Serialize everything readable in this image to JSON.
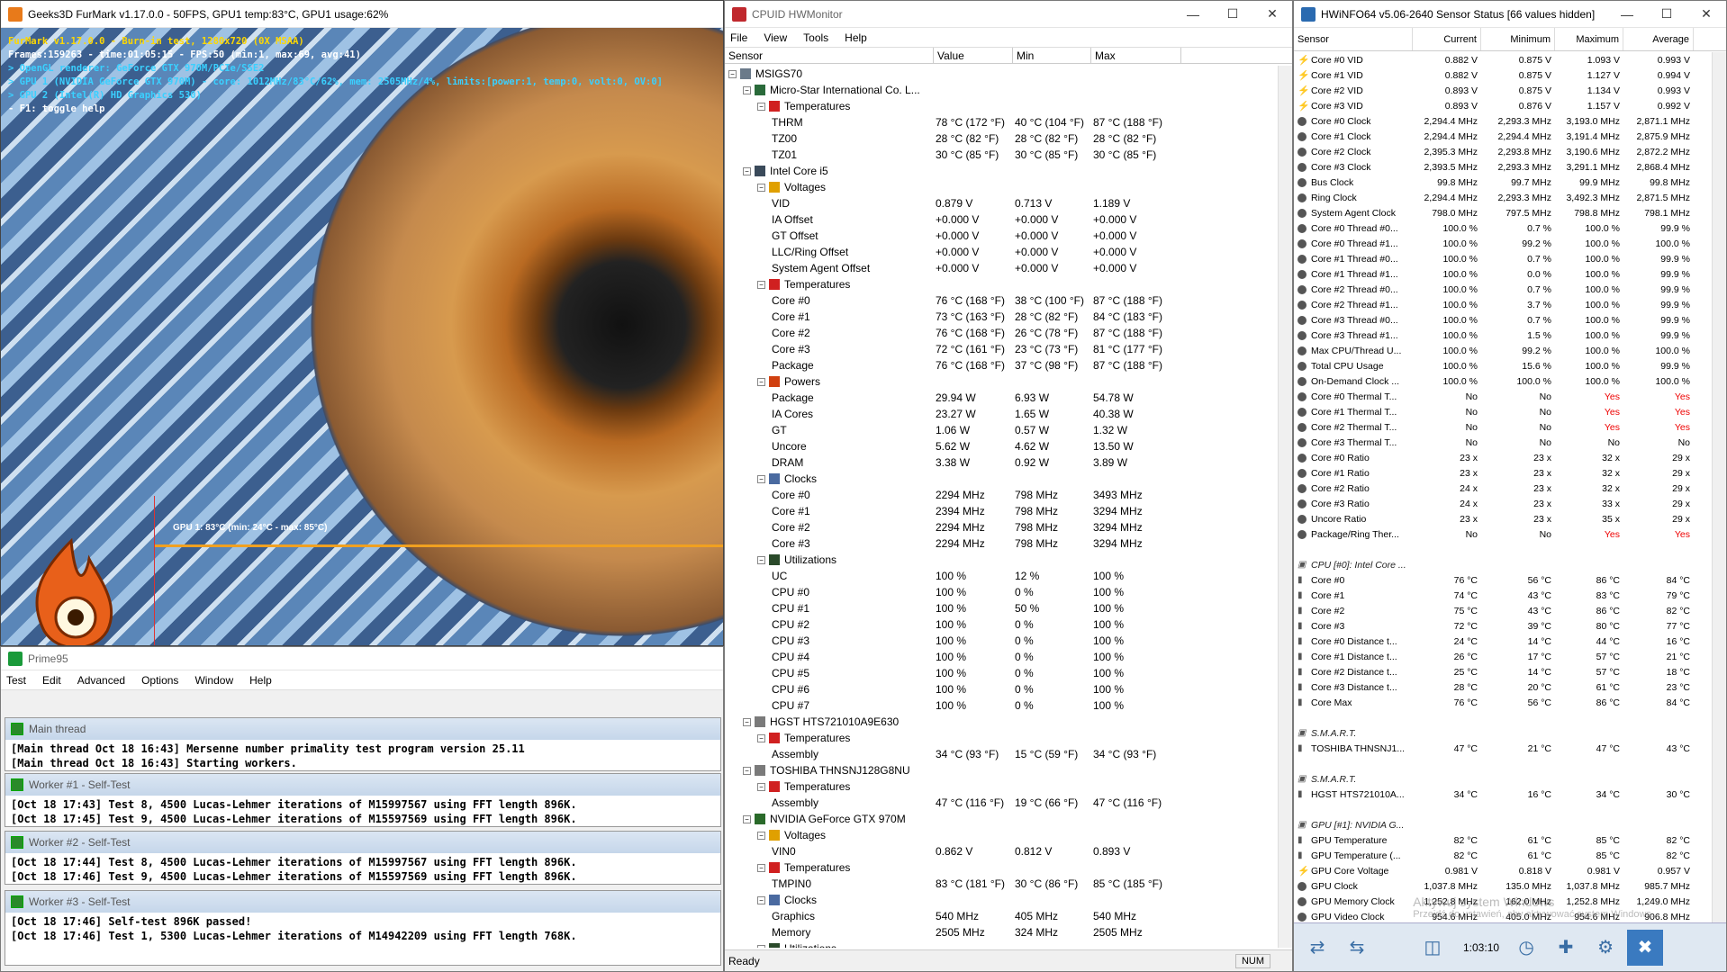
{
  "furmark": {
    "title": "Geeks3D FurMark v1.17.0.0 - 50FPS, GPU1 temp:83°C, GPU1 usage:62%",
    "hud": [
      {
        "text": "FurMark v1.17.0.0 - Burn-in test, 1280x720 (0X MSAA)",
        "color": "#ffd800"
      },
      {
        "text": "Frames:159263 - time:01:05:15 - FPS:50 (min:1, max:69, avg:41)",
        "color": "#ffffff"
      },
      {
        "text": "> OpenGL renderer: GeForce GTX 970M/PCIe/SSE2",
        "color": "#3ad0ff"
      },
      {
        "text": "> GPU 1 (NVIDIA GeForce GTX 970M) - core: 1012MHz/83°C/62%, mem: 2505MHz/4%, limits:[power:1, temp:0, volt:0, OV:0]",
        "color": "#3ad0ff"
      },
      {
        "text": "> GPU 2 (Intel(R) HD Graphics 530)",
        "color": "#3ad0ff"
      },
      {
        "text": "- F1: toggle help",
        "color": "#ffffff"
      }
    ],
    "graph_label": "GPU 1: 83°C (min: 24°C - max: 85°C)"
  },
  "prime95": {
    "title": "Prime95",
    "menu": [
      "Test",
      "Edit",
      "Advanced",
      "Options",
      "Window",
      "Help"
    ],
    "windows": [
      {
        "title": "Main thread",
        "lines": [
          "[Main thread Oct 18 16:43] Mersenne number primality test program version 25.11",
          "[Main thread Oct 18 16:43] Starting workers."
        ]
      },
      {
        "title": "Worker #1 - Self-Test",
        "lines": [
          "[Oct 18 17:43] Test 8, 4500 Lucas-Lehmer iterations of M15997567 using FFT length 896K.",
          "[Oct 18 17:45] Test 9, 4500 Lucas-Lehmer iterations of M15597569 using FFT length 896K."
        ]
      },
      {
        "title": "Worker #2 - Self-Test",
        "lines": [
          "[Oct 18 17:44] Test 8, 4500 Lucas-Lehmer iterations of M15997567 using FFT length 896K.",
          "[Oct 18 17:46] Test 9, 4500 Lucas-Lehmer iterations of M15597569 using FFT length 896K."
        ]
      },
      {
        "title": "Worker #3 - Self-Test",
        "lines": [
          "[Oct 18 17:46] Self-test 896K passed!",
          "[Oct 18 17:46] Test 1, 5300 Lucas-Lehmer iterations of M14942209 using FFT length 768K."
        ]
      }
    ]
  },
  "hwmonitor": {
    "title": "CPUID HWMonitor",
    "menu": [
      "File",
      "View",
      "Tools",
      "Help"
    ],
    "columns": [
      "Sensor",
      "Value",
      "Min",
      "Max"
    ],
    "status": "Ready",
    "num": "NUM",
    "rows": [
      {
        "lvl": 0,
        "t": "MSIGS70",
        "v": "",
        "mi": "",
        "ma": "",
        "ic": "pc"
      },
      {
        "lvl": 1,
        "t": "Micro-Star International Co. L...",
        "v": "",
        "mi": "",
        "ma": "",
        "ic": "board"
      },
      {
        "lvl": 2,
        "t": "Temperatures",
        "v": "",
        "mi": "",
        "ma": "",
        "ic": "temp"
      },
      {
        "lvl": 3,
        "t": "THRM",
        "v": "78 °C  (172 °F)",
        "mi": "40 °C  (104 °F)",
        "ma": "87 °C  (188 °F)"
      },
      {
        "lvl": 3,
        "t": "TZ00",
        "v": "28 °C  (82 °F)",
        "mi": "28 °C  (82 °F)",
        "ma": "28 °C  (82 °F)"
      },
      {
        "lvl": 3,
        "t": "TZ01",
        "v": "30 °C  (85 °F)",
        "mi": "30 °C  (85 °F)",
        "ma": "30 °C  (85 °F)"
      },
      {
        "lvl": 1,
        "t": "Intel Core i5",
        "v": "",
        "mi": "",
        "ma": "",
        "ic": "chip"
      },
      {
        "lvl": 2,
        "t": "Voltages",
        "v": "",
        "mi": "",
        "ma": "",
        "ic": "volt"
      },
      {
        "lvl": 3,
        "t": "VID",
        "v": "0.879 V",
        "mi": "0.713 V",
        "ma": "1.189 V"
      },
      {
        "lvl": 3,
        "t": "IA Offset",
        "v": "+0.000 V",
        "mi": "+0.000 V",
        "ma": "+0.000 V"
      },
      {
        "lvl": 3,
        "t": "GT Offset",
        "v": "+0.000 V",
        "mi": "+0.000 V",
        "ma": "+0.000 V"
      },
      {
        "lvl": 3,
        "t": "LLC/Ring Offset",
        "v": "+0.000 V",
        "mi": "+0.000 V",
        "ma": "+0.000 V"
      },
      {
        "lvl": 3,
        "t": "System Agent Offset",
        "v": "+0.000 V",
        "mi": "+0.000 V",
        "ma": "+0.000 V"
      },
      {
        "lvl": 2,
        "t": "Temperatures",
        "v": "",
        "mi": "",
        "ma": "",
        "ic": "temp"
      },
      {
        "lvl": 3,
        "t": "Core #0",
        "v": "76 °C  (168 °F)",
        "mi": "38 °C  (100 °F)",
        "ma": "87 °C  (188 °F)"
      },
      {
        "lvl": 3,
        "t": "Core #1",
        "v": "73 °C  (163 °F)",
        "mi": "28 °C  (82 °F)",
        "ma": "84 °C  (183 °F)"
      },
      {
        "lvl": 3,
        "t": "Core #2",
        "v": "76 °C  (168 °F)",
        "mi": "26 °C  (78 °F)",
        "ma": "87 °C  (188 °F)"
      },
      {
        "lvl": 3,
        "t": "Core #3",
        "v": "72 °C  (161 °F)",
        "mi": "23 °C  (73 °F)",
        "ma": "81 °C  (177 °F)"
      },
      {
        "lvl": 3,
        "t": "Package",
        "v": "76 °C  (168 °F)",
        "mi": "37 °C  (98 °F)",
        "ma": "87 °C  (188 °F)"
      },
      {
        "lvl": 2,
        "t": "Powers",
        "v": "",
        "mi": "",
        "ma": "",
        "ic": "power"
      },
      {
        "lvl": 3,
        "t": "Package",
        "v": "29.94 W",
        "mi": "6.93 W",
        "ma": "54.78 W"
      },
      {
        "lvl": 3,
        "t": "IA Cores",
        "v": "23.27 W",
        "mi": "1.65 W",
        "ma": "40.38 W"
      },
      {
        "lvl": 3,
        "t": "GT",
        "v": "1.06 W",
        "mi": "0.57 W",
        "ma": "1.32 W"
      },
      {
        "lvl": 3,
        "t": "Uncore",
        "v": "5.62 W",
        "mi": "4.62 W",
        "ma": "13.50 W"
      },
      {
        "lvl": 3,
        "t": "DRAM",
        "v": "3.38 W",
        "mi": "0.92 W",
        "ma": "3.89 W"
      },
      {
        "lvl": 2,
        "t": "Clocks",
        "v": "",
        "mi": "",
        "ma": "",
        "ic": "clock"
      },
      {
        "lvl": 3,
        "t": "Core #0",
        "v": "2294 MHz",
        "mi": "798 MHz",
        "ma": "3493 MHz"
      },
      {
        "lvl": 3,
        "t": "Core #1",
        "v": "2394 MHz",
        "mi": "798 MHz",
        "ma": "3294 MHz"
      },
      {
        "lvl": 3,
        "t": "Core #2",
        "v": "2294 MHz",
        "mi": "798 MHz",
        "ma": "3294 MHz"
      },
      {
        "lvl": 3,
        "t": "Core #3",
        "v": "2294 MHz",
        "mi": "798 MHz",
        "ma": "3294 MHz"
      },
      {
        "lvl": 2,
        "t": "Utilizations",
        "v": "",
        "mi": "",
        "ma": "",
        "ic": "util"
      },
      {
        "lvl": 3,
        "t": "UC",
        "v": "100 %",
        "mi": "12 %",
        "ma": "100 %"
      },
      {
        "lvl": 3,
        "t": "CPU #0",
        "v": "100 %",
        "mi": "0 %",
        "ma": "100 %"
      },
      {
        "lvl": 3,
        "t": "CPU #1",
        "v": "100 %",
        "mi": "50 %",
        "ma": "100 %"
      },
      {
        "lvl": 3,
        "t": "CPU #2",
        "v": "100 %",
        "mi": "0 %",
        "ma": "100 %"
      },
      {
        "lvl": 3,
        "t": "CPU #3",
        "v": "100 %",
        "mi": "0 %",
        "ma": "100 %"
      },
      {
        "lvl": 3,
        "t": "CPU #4",
        "v": "100 %",
        "mi": "0 %",
        "ma": "100 %"
      },
      {
        "lvl": 3,
        "t": "CPU #5",
        "v": "100 %",
        "mi": "0 %",
        "ma": "100 %"
      },
      {
        "lvl": 3,
        "t": "CPU #6",
        "v": "100 %",
        "mi": "0 %",
        "ma": "100 %"
      },
      {
        "lvl": 3,
        "t": "CPU #7",
        "v": "100 %",
        "mi": "0 %",
        "ma": "100 %"
      },
      {
        "lvl": 1,
        "t": "HGST HTS721010A9E630",
        "v": "",
        "mi": "",
        "ma": "",
        "ic": "disk"
      },
      {
        "lvl": 2,
        "t": "Temperatures",
        "v": "",
        "mi": "",
        "ma": "",
        "ic": "temp"
      },
      {
        "lvl": 3,
        "t": "Assembly",
        "v": "34 °C  (93 °F)",
        "mi": "15 °C  (59 °F)",
        "ma": "34 °C  (93 °F)"
      },
      {
        "lvl": 1,
        "t": "TOSHIBA THNSNJ128G8NU",
        "v": "",
        "mi": "",
        "ma": "",
        "ic": "disk"
      },
      {
        "lvl": 2,
        "t": "Temperatures",
        "v": "",
        "mi": "",
        "ma": "",
        "ic": "temp"
      },
      {
        "lvl": 3,
        "t": "Assembly",
        "v": "47 °C  (116 °F)",
        "mi": "19 °C  (66 °F)",
        "ma": "47 °C  (116 °F)"
      },
      {
        "lvl": 1,
        "t": "NVIDIA GeForce GTX 970M",
        "v": "",
        "mi": "",
        "ma": "",
        "ic": "gpu"
      },
      {
        "lvl": 2,
        "t": "Voltages",
        "v": "",
        "mi": "",
        "ma": "",
        "ic": "volt"
      },
      {
        "lvl": 3,
        "t": "VIN0",
        "v": "0.862 V",
        "mi": "0.812 V",
        "ma": "0.893 V"
      },
      {
        "lvl": 2,
        "t": "Temperatures",
        "v": "",
        "mi": "",
        "ma": "",
        "ic": "temp"
      },
      {
        "lvl": 3,
        "t": "TMPIN0",
        "v": "83 °C  (181 °F)",
        "mi": "30 °C  (86 °F)",
        "ma": "85 °C  (185 °F)"
      },
      {
        "lvl": 2,
        "t": "Clocks",
        "v": "",
        "mi": "",
        "ma": "",
        "ic": "clock"
      },
      {
        "lvl": 3,
        "t": "Graphics",
        "v": "540 MHz",
        "mi": "405 MHz",
        "ma": "540 MHz"
      },
      {
        "lvl": 3,
        "t": "Memory",
        "v": "2505 MHz",
        "mi": "324 MHz",
        "ma": "2505 MHz"
      },
      {
        "lvl": 2,
        "t": "Utilizations",
        "v": "",
        "mi": "",
        "ma": "",
        "ic": "util"
      }
    ]
  },
  "hwinfo": {
    "title": "HWiNFO64 v5.06-2640 Sensor Status [66 values hidden]",
    "columns": [
      "Sensor",
      "Current",
      "Minimum",
      "Maximum",
      "Average"
    ],
    "elapsed": "1:03:10",
    "watermark": [
      "Aktywuj system Windows",
      "Przejdź do ustawień, aby aktywować system Windows."
    ],
    "rows": [
      {
        "k": "volt",
        "n": "Core #0 VID",
        "c": "0.882 V",
        "mi": "0.875 V",
        "ma": "1.093 V",
        "a": "0.993 V"
      },
      {
        "k": "volt",
        "n": "Core #1 VID",
        "c": "0.882 V",
        "mi": "0.875 V",
        "ma": "1.127 V",
        "a": "0.994 V"
      },
      {
        "k": "volt",
        "n": "Core #2 VID",
        "c": "0.893 V",
        "mi": "0.875 V",
        "ma": "1.134 V",
        "a": "0.993 V"
      },
      {
        "k": "volt",
        "n": "Core #3 VID",
        "c": "0.893 V",
        "mi": "0.876 V",
        "ma": "1.157 V",
        "a": "0.992 V"
      },
      {
        "k": "dot",
        "n": "Core #0 Clock",
        "c": "2,294.4 MHz",
        "mi": "2,293.3 MHz",
        "ma": "3,193.0 MHz",
        "a": "2,871.1 MHz"
      },
      {
        "k": "dot",
        "n": "Core #1 Clock",
        "c": "2,294.4 MHz",
        "mi": "2,294.4 MHz",
        "ma": "3,191.4 MHz",
        "a": "2,875.9 MHz"
      },
      {
        "k": "dot",
        "n": "Core #2 Clock",
        "c": "2,395.3 MHz",
        "mi": "2,293.8 MHz",
        "ma": "3,190.6 MHz",
        "a": "2,872.2 MHz"
      },
      {
        "k": "dot",
        "n": "Core #3 Clock",
        "c": "2,393.5 MHz",
        "mi": "2,293.3 MHz",
        "ma": "3,291.1 MHz",
        "a": "2,868.4 MHz"
      },
      {
        "k": "dot",
        "n": "Bus Clock",
        "c": "99.8 MHz",
        "mi": "99.7 MHz",
        "ma": "99.9 MHz",
        "a": "99.8 MHz"
      },
      {
        "k": "dot",
        "n": "Ring Clock",
        "c": "2,294.4 MHz",
        "mi": "2,293.3 MHz",
        "ma": "3,492.3 MHz",
        "a": "2,871.5 MHz"
      },
      {
        "k": "dot",
        "n": "System Agent Clock",
        "c": "798.0 MHz",
        "mi": "797.5 MHz",
        "ma": "798.8 MHz",
        "a": "798.1 MHz"
      },
      {
        "k": "dot",
        "n": "Core #0 Thread #0...",
        "c": "100.0 %",
        "mi": "0.7 %",
        "ma": "100.0 %",
        "a": "99.9 %"
      },
      {
        "k": "dot",
        "n": "Core #0 Thread #1...",
        "c": "100.0 %",
        "mi": "99.2 %",
        "ma": "100.0 %",
        "a": "100.0 %"
      },
      {
        "k": "dot",
        "n": "Core #1 Thread #0...",
        "c": "100.0 %",
        "mi": "0.7 %",
        "ma": "100.0 %",
        "a": "99.9 %"
      },
      {
        "k": "dot",
        "n": "Core #1 Thread #1...",
        "c": "100.0 %",
        "mi": "0.0 %",
        "ma": "100.0 %",
        "a": "99.9 %"
      },
      {
        "k": "dot",
        "n": "Core #2 Thread #0...",
        "c": "100.0 %",
        "mi": "0.7 %",
        "ma": "100.0 %",
        "a": "99.9 %"
      },
      {
        "k": "dot",
        "n": "Core #2 Thread #1...",
        "c": "100.0 %",
        "mi": "3.7 %",
        "ma": "100.0 %",
        "a": "99.9 %"
      },
      {
        "k": "dot",
        "n": "Core #3 Thread #0...",
        "c": "100.0 %",
        "mi": "0.7 %",
        "ma": "100.0 %",
        "a": "99.9 %"
      },
      {
        "k": "dot",
        "n": "Core #3 Thread #1...",
        "c": "100.0 %",
        "mi": "1.5 %",
        "ma": "100.0 %",
        "a": "99.9 %"
      },
      {
        "k": "dot",
        "n": "Max CPU/Thread U...",
        "c": "100.0 %",
        "mi": "99.2 %",
        "ma": "100.0 %",
        "a": "100.0 %"
      },
      {
        "k": "dot",
        "n": "Total CPU Usage",
        "c": "100.0 %",
        "mi": "15.6 %",
        "ma": "100.0 %",
        "a": "99.9 %"
      },
      {
        "k": "dot",
        "n": "On-Demand Clock ...",
        "c": "100.0 %",
        "mi": "100.0 %",
        "ma": "100.0 %",
        "a": "100.0 %"
      },
      {
        "k": "dot",
        "n": "Core #0 Thermal T...",
        "c": "No",
        "mi": "No",
        "ma": "Yes",
        "a": "Yes",
        "red": true
      },
      {
        "k": "dot",
        "n": "Core #1 Thermal T...",
        "c": "No",
        "mi": "No",
        "ma": "Yes",
        "a": "Yes",
        "red": true
      },
      {
        "k": "dot",
        "n": "Core #2 Thermal T...",
        "c": "No",
        "mi": "No",
        "ma": "Yes",
        "a": "Yes",
        "red": true
      },
      {
        "k": "dot",
        "n": "Core #3 Thermal T...",
        "c": "No",
        "mi": "No",
        "ma": "No",
        "a": "No"
      },
      {
        "k": "dot",
        "n": "Core #0 Ratio",
        "c": "23 x",
        "mi": "23 x",
        "ma": "32 x",
        "a": "29 x"
      },
      {
        "k": "dot",
        "n": "Core #1 Ratio",
        "c": "23 x",
        "mi": "23 x",
        "ma": "32 x",
        "a": "29 x"
      },
      {
        "k": "dot",
        "n": "Core #2 Ratio",
        "c": "24 x",
        "mi": "23 x",
        "ma": "32 x",
        "a": "29 x"
      },
      {
        "k": "dot",
        "n": "Core #3 Ratio",
        "c": "24 x",
        "mi": "23 x",
        "ma": "33 x",
        "a": "29 x"
      },
      {
        "k": "dot",
        "n": "Uncore Ratio",
        "c": "23 x",
        "mi": "23 x",
        "ma": "35 x",
        "a": "29 x"
      },
      {
        "k": "dot",
        "n": "Package/Ring Ther...",
        "c": "No",
        "mi": "No",
        "ma": "Yes",
        "a": "Yes",
        "red": true
      },
      {
        "k": "blank"
      },
      {
        "k": "sect",
        "n": "CPU [#0]: Intel Core ..."
      },
      {
        "k": "therm",
        "n": "Core #0",
        "c": "76 °C",
        "mi": "56 °C",
        "ma": "86 °C",
        "a": "84 °C"
      },
      {
        "k": "therm",
        "n": "Core #1",
        "c": "74 °C",
        "mi": "43 °C",
        "ma": "83 °C",
        "a": "79 °C"
      },
      {
        "k": "therm",
        "n": "Core #2",
        "c": "75 °C",
        "mi": "43 °C",
        "ma": "86 °C",
        "a": "82 °C"
      },
      {
        "k": "therm",
        "n": "Core #3",
        "c": "72 °C",
        "mi": "39 °C",
        "ma": "80 °C",
        "a": "77 °C"
      },
      {
        "k": "therm",
        "n": "Core #0 Distance t...",
        "c": "24 °C",
        "mi": "14 °C",
        "ma": "44 °C",
        "a": "16 °C"
      },
      {
        "k": "therm",
        "n": "Core #1 Distance t...",
        "c": "26 °C",
        "mi": "17 °C",
        "ma": "57 °C",
        "a": "21 °C"
      },
      {
        "k": "therm",
        "n": "Core #2 Distance t...",
        "c": "25 °C",
        "mi": "14 °C",
        "ma": "57 °C",
        "a": "18 °C"
      },
      {
        "k": "therm",
        "n": "Core #3 Distance t...",
        "c": "28 °C",
        "mi": "20 °C",
        "ma": "61 °C",
        "a": "23 °C"
      },
      {
        "k": "therm",
        "n": "Core Max",
        "c": "76 °C",
        "mi": "56 °C",
        "ma": "86 °C",
        "a": "84 °C"
      },
      {
        "k": "blank"
      },
      {
        "k": "sect",
        "n": "S.M.A.R.T."
      },
      {
        "k": "therm",
        "n": "TOSHIBA THNSNJ1...",
        "c": "47 °C",
        "mi": "21 °C",
        "ma": "47 °C",
        "a": "43 °C"
      },
      {
        "k": "blank"
      },
      {
        "k": "sect",
        "n": "S.M.A.R.T."
      },
      {
        "k": "therm",
        "n": "HGST HTS721010A...",
        "c": "34 °C",
        "mi": "16 °C",
        "ma": "34 °C",
        "a": "30 °C"
      },
      {
        "k": "blank"
      },
      {
        "k": "sect",
        "n": "GPU [#1]: NVIDIA G..."
      },
      {
        "k": "therm",
        "n": "GPU Temperature",
        "c": "82 °C",
        "mi": "61 °C",
        "ma": "85 °C",
        "a": "82 °C"
      },
      {
        "k": "therm",
        "n": "GPU Temperature (...",
        "c": "82 °C",
        "mi": "61 °C",
        "ma": "85 °C",
        "a": "82 °C"
      },
      {
        "k": "volt",
        "n": "GPU Core Voltage",
        "c": "0.981 V",
        "mi": "0.818 V",
        "ma": "0.981 V",
        "a": "0.957 V"
      },
      {
        "k": "dot",
        "n": "GPU Clock",
        "c": "1,037.8 MHz",
        "mi": "135.0 MHz",
        "ma": "1,037.8 MHz",
        "a": "985.7 MHz"
      },
      {
        "k": "dot",
        "n": "GPU Memory Clock",
        "c": "1,252.8 MHz",
        "mi": "162.0 MHz",
        "ma": "1,252.8 MHz",
        "a": "1,249.0 MHz"
      },
      {
        "k": "dot",
        "n": "GPU Video Clock",
        "c": "954.6 MHz",
        "mi": "405.0 MHz",
        "ma": "954.6 MHz",
        "a": "906.8 MHz"
      }
    ]
  }
}
